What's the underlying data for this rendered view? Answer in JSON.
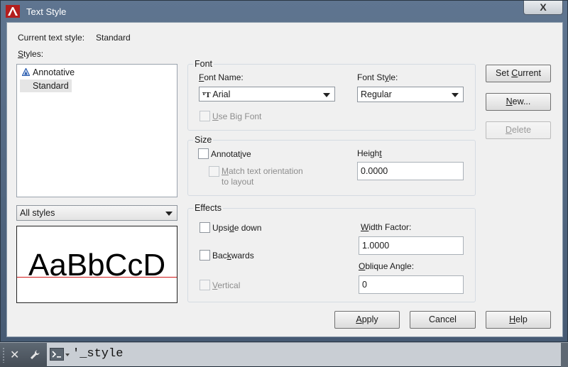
{
  "window": {
    "title": "Text Style",
    "close_label": "X"
  },
  "current": {
    "label": "Current text style:",
    "value": "Standard"
  },
  "styles": {
    "label": "Styles:",
    "items": [
      {
        "label": "Annotative",
        "icon": "annotative-icon"
      },
      {
        "label": "Standard",
        "selected": true
      }
    ],
    "filter_value": "All styles"
  },
  "preview": {
    "text": "AaBbCcD"
  },
  "font": {
    "group_title": "Font",
    "name_label": "Font Name:",
    "name_value": "Arial",
    "name_icon": "truetype-font-icon",
    "style_label": "Font Style:",
    "style_value": "Regular",
    "big_font_label": "Use Big Font"
  },
  "size": {
    "group_title": "Size",
    "annotative_label": "Annotative",
    "match_label_line1": "Match text orientation",
    "match_label_line2": "to layout",
    "height_label": "Height",
    "height_value": "0.0000"
  },
  "effects": {
    "group_title": "Effects",
    "upside_down_label": "Upside down",
    "backwards_label": "Backwards",
    "vertical_label": "Vertical",
    "width_factor_label": "Width Factor:",
    "width_factor_value": "1.0000",
    "oblique_label": "Oblique Angle:",
    "oblique_value": "0"
  },
  "buttons": {
    "set_current": "Set Current",
    "new": "New...",
    "delete": "Delete",
    "apply": "Apply",
    "cancel": "Cancel",
    "help": "Help"
  },
  "command_line": {
    "text": "'_style"
  }
}
